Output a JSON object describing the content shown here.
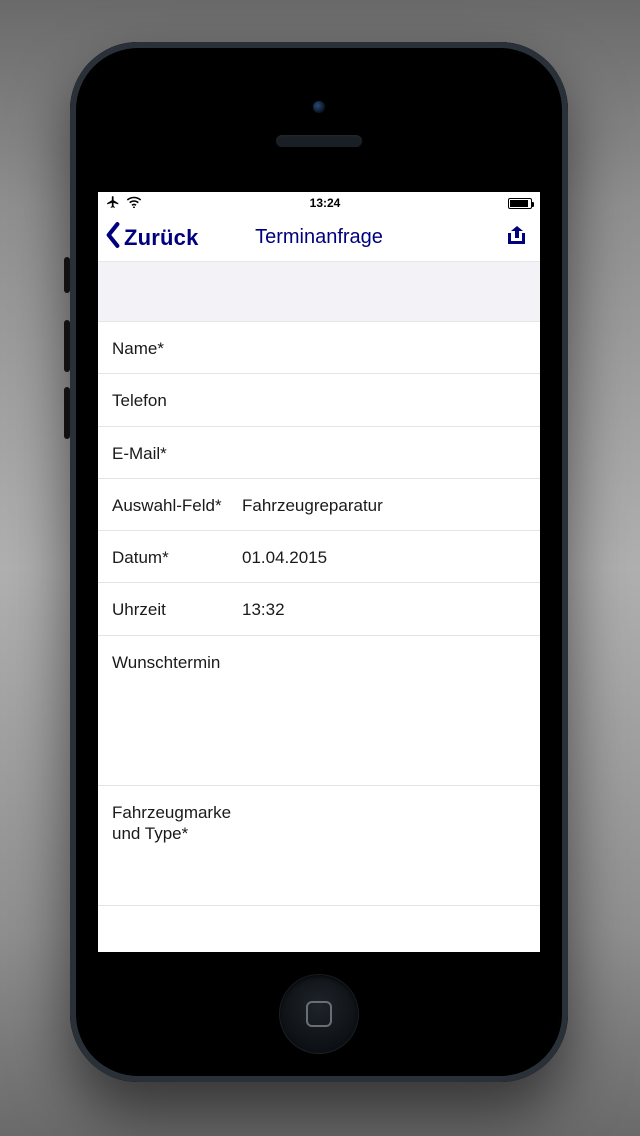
{
  "colors": {
    "accent": "#00007e"
  },
  "statusbar": {
    "time": "13:24"
  },
  "nav": {
    "back_label": "Zurück",
    "title": "Terminanfrage"
  },
  "form": {
    "name": {
      "label": "Name*",
      "value": ""
    },
    "telefon": {
      "label": "Telefon",
      "value": ""
    },
    "email": {
      "label": "E-Mail*",
      "value": ""
    },
    "auswahl": {
      "label": "Auswahl-Feld*",
      "value": "Fahrzeugreparatur"
    },
    "datum": {
      "label": "Datum*",
      "value": "01.04.2015"
    },
    "uhrzeit": {
      "label": "Uhrzeit",
      "value": "13:32"
    },
    "wunschtermin": {
      "label": "Wunschtermin",
      "value": ""
    },
    "fahrzeug": {
      "label": "Fahrzeugmarke und Type*",
      "value": ""
    }
  }
}
